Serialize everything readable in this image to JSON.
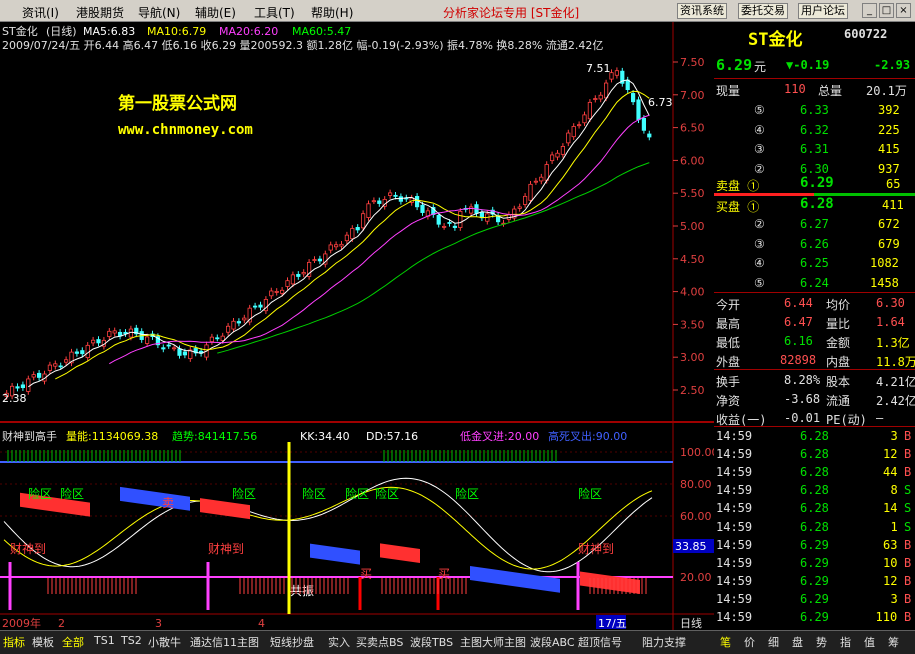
{
  "menu": {
    "items": [
      "资讯(I)",
      "港股期货",
      "导航(N)",
      "辅助(E)",
      "工具(T)",
      "帮助(H)"
    ],
    "title": "分析家论坛专用 [ST金化]",
    "buttons": [
      "资讯系统",
      "委托交易",
      "用户论坛"
    ],
    "window": [
      "_",
      "□",
      "×"
    ]
  },
  "chart_header": {
    "name": "ST金化",
    "period": "(日线)",
    "ma5": "MA5:6.83",
    "ma10": "MA10:6.79",
    "ma20": "MA20:6.20",
    "ma60": "MA60:5.47",
    "info": "2009/07/24/五 开6.44 高6.47 低6.16 收6.29 量200592.3 额1.28亿 幅-0.19(-2.93%) 振4.78% 换8.28% 流通2.42亿"
  },
  "watermark": {
    "line1": "第一股票公式网",
    "line2": "www.chnmoney.com"
  },
  "chart_labels": {
    "high": "7.51",
    "last": "6.73",
    "low": "2.38",
    "cursor_val": "33.85",
    "cursor_date": "17/五",
    "axis_mode": "日线"
  },
  "y_axis_price": [
    "7.50",
    "7.00",
    "6.50",
    "6.00",
    "5.50",
    "5.00",
    "4.50",
    "4.00",
    "3.50",
    "3.00",
    "2.50"
  ],
  "y_axis_ind": [
    "100.00",
    "80.00",
    "60.00",
    "20.00"
  ],
  "x_axis": [
    "2009年",
    "2",
    "3",
    "4"
  ],
  "indicator": {
    "name": "财神到高手",
    "vol": "量能:1134069.38",
    "trend": "趋势:841417.56",
    "kk": "KK:34.40",
    "dd": "DD:57.16",
    "low_cross": "低金叉进:20.00",
    "high_cross": "高死叉出:90.00"
  },
  "markers": {
    "risk": [
      "险区",
      "险区",
      "险区",
      "险区",
      "险区",
      "险区",
      "险区",
      "险区"
    ],
    "gold": [
      "财神到",
      "财神到",
      "财神到"
    ],
    "sell": "卖",
    "buy": [
      "买",
      "买"
    ],
    "resonance": "共振"
  },
  "quote": {
    "name": "ST金化",
    "code": "600722",
    "price": "6.29",
    "unit": "元",
    "change": "▼-0.19",
    "pct": "-2.93",
    "cur_vol_l": "现量",
    "cur_vol": "110",
    "tot_vol_l": "总量",
    "tot_vol": "20.1万",
    "sells": [
      {
        "n": "⑤",
        "p": "6.33",
        "v": "392"
      },
      {
        "n": "④",
        "p": "6.32",
        "v": "225"
      },
      {
        "n": "③",
        "p": "6.31",
        "v": "415"
      },
      {
        "n": "②",
        "p": "6.30",
        "v": "937"
      }
    ],
    "sell1": {
      "l": "卖盘 ①",
      "p": "6.29",
      "v": "65"
    },
    "buy1": {
      "l": "买盘 ①",
      "p": "6.28",
      "v": "411"
    },
    "buys": [
      {
        "n": "②",
        "p": "6.27",
        "v": "672"
      },
      {
        "n": "③",
        "p": "6.26",
        "v": "679"
      },
      {
        "n": "④",
        "p": "6.25",
        "v": "1082"
      },
      {
        "n": "⑤",
        "p": "6.24",
        "v": "1458"
      }
    ],
    "stats": [
      [
        "今开",
        "6.44",
        "均价",
        "6.30"
      ],
      [
        "最高",
        "6.47",
        "量比",
        "1.64"
      ],
      [
        "最低",
        "6.16",
        "金额",
        "1.3亿"
      ],
      [
        "外盘",
        "82898",
        "内盘",
        "11.8万"
      ],
      [
        "换手",
        "8.28%",
        "股本",
        "4.21亿"
      ],
      [
        "净资",
        "-3.68",
        "流通",
        "2.42亿"
      ],
      [
        "收益(一)",
        "-0.01",
        "PE(动)",
        "—"
      ]
    ]
  },
  "ticks": [
    [
      "14:59",
      "6.28",
      "3",
      "B"
    ],
    [
      "14:59",
      "6.28",
      "12",
      "B"
    ],
    [
      "14:59",
      "6.28",
      "44",
      "B"
    ],
    [
      "14:59",
      "6.28",
      "8",
      "S"
    ],
    [
      "14:59",
      "6.28",
      "14",
      "S"
    ],
    [
      "14:59",
      "6.28",
      "1",
      "S"
    ],
    [
      "14:59",
      "6.29",
      "63",
      "B"
    ],
    [
      "14:59",
      "6.29",
      "10",
      "B"
    ],
    [
      "14:59",
      "6.29",
      "12",
      "B"
    ],
    [
      "14:59",
      "6.29",
      "3",
      "B"
    ],
    [
      "14:59",
      "6.29",
      "110",
      "B"
    ]
  ],
  "bottom_tabs": [
    "指标",
    "模板",
    "全部",
    "TS1",
    "TS2",
    "小散牛",
    "通达信11主图",
    "短线抄盘",
    "实入",
    "买卖点BS",
    "波段TBS",
    "主图大师主图",
    "波段ABC",
    "超顶信号",
    "阻力支撑"
  ],
  "bottom_right": [
    "笔",
    "价",
    "细",
    "盘",
    "势",
    "指",
    "值",
    "筹"
  ]
}
